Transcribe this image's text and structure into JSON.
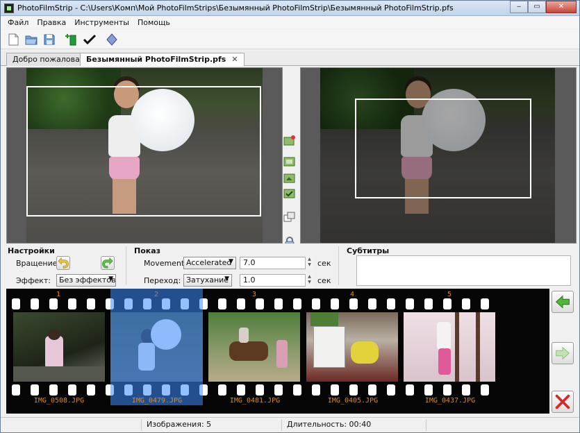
{
  "window": {
    "title": "PhotoFilmStrip - C:\\Users\\Комп\\Мой PhotoFilmStrips\\Безымянный PhotoFilmStrip\\Безымянный PhotoFilmStrip.pfs",
    "minimize": "‒",
    "maximize": "▭",
    "close": "✕"
  },
  "menu": [
    "Файл",
    "Правка",
    "Инструменты",
    "Помощь"
  ],
  "toolbar": {
    "icons": [
      "new-document-icon",
      "open-folder-icon",
      "save-icon",
      "add-pictures-icon",
      "render-check-icon",
      "diamond-icon"
    ]
  },
  "tabs": [
    {
      "label": "Добро пожаловать",
      "active": false
    },
    {
      "label": "Безымянный PhotoFilmStrip.pfs",
      "active": true,
      "close": "✕"
    }
  ],
  "settings": {
    "group_title": "Настройки",
    "rotation_label": "Вращение:",
    "effect_label": "Эффект:",
    "effect_value": "Без эффектов"
  },
  "show": {
    "group_title": "Показ",
    "movement_label": "Movement:",
    "movement_value": "Accelerated",
    "movement_duration": "7.0",
    "transition_label": "Переход:",
    "transition_value": "Затухание",
    "transition_duration": "1.0",
    "unit": "сек"
  },
  "subtitles": {
    "group_title": "Субтитры",
    "text": ""
  },
  "filmstrip": {
    "frames": [
      {
        "number": "1",
        "filename": "IMG_0508.JPG"
      },
      {
        "number": "2",
        "filename": "IMG_0479.JPG",
        "selected": true
      },
      {
        "number": "3",
        "filename": "IMG_0481.JPG"
      },
      {
        "number": "4",
        "filename": "IMG_0405.JPG"
      },
      {
        "number": "5",
        "filename": "IMG_0437.JPG"
      }
    ]
  },
  "side_buttons": [
    "move-left-icon",
    "move-right-icon",
    "delete-icon"
  ],
  "status": {
    "images": "Изображения: 5",
    "duration": "Длительность: 00:40"
  },
  "colors": {
    "accent": "#3c8cff",
    "film_text": "#e68a1a",
    "film_bg": "#050505"
  }
}
